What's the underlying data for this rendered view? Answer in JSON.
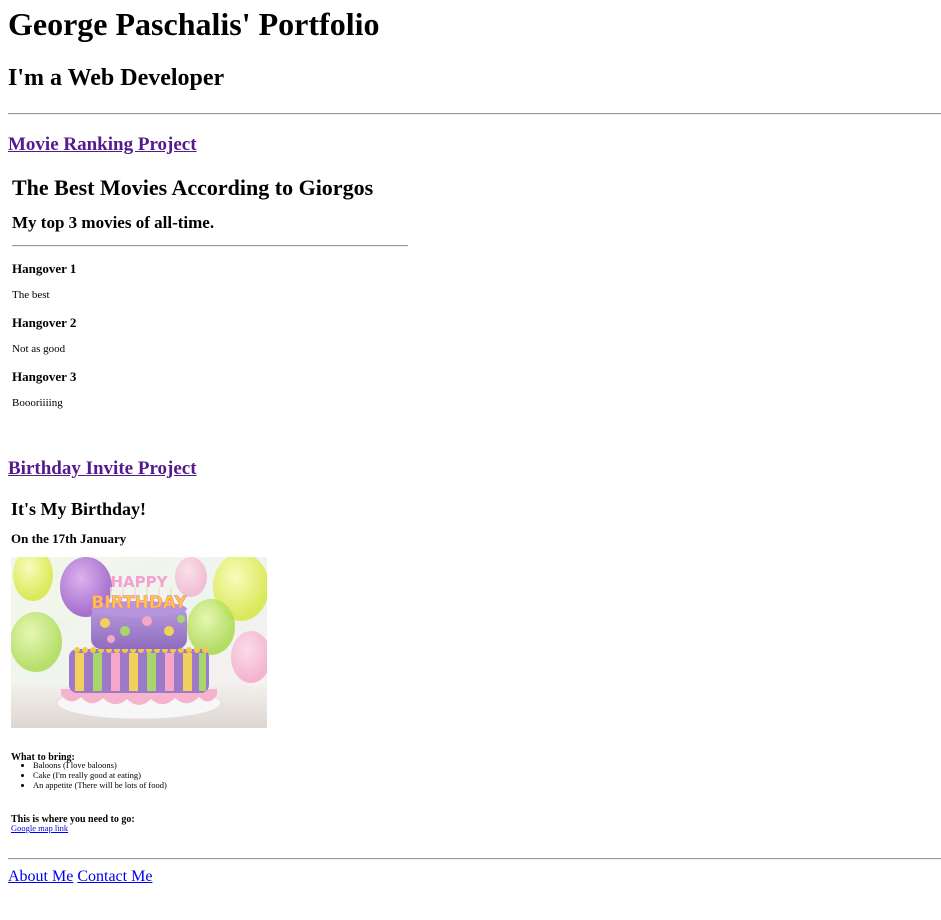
{
  "header": {
    "title": "George Paschalis' Portfolio",
    "subtitle": "I'm a Web Developer"
  },
  "projects": {
    "movie_link": "Movie Ranking Project",
    "birthday_link": "Birthday Invite Project"
  },
  "movies": {
    "title": "The Best Movies According to Giorgos",
    "subtitle": "My top 3 movies of all-time.",
    "items": [
      {
        "title": "Hangover 1",
        "desc": "The best"
      },
      {
        "title": "Hangover 2",
        "desc": "Not as good"
      },
      {
        "title": "Hangover 3",
        "desc": "Boooriiiing"
      }
    ]
  },
  "birthday": {
    "title": "It's My Birthday!",
    "date": "On the 17th January",
    "cake_text": "HAPPY BIRTHDAY",
    "bring_label": "What to bring:",
    "bring_items": [
      "Baloons (I love baloons)",
      "Cake (I'm really good at eating)",
      "An appetite (There will be lots of food)"
    ],
    "where_label": "This is where you need to go:",
    "map_link": "Google map link"
  },
  "footer": {
    "about": "About Me",
    "contact": "Contact Me"
  },
  "colors": {
    "visited_link": "#551a8b",
    "link": "#0000ee",
    "rule": "#9a9a9a"
  }
}
